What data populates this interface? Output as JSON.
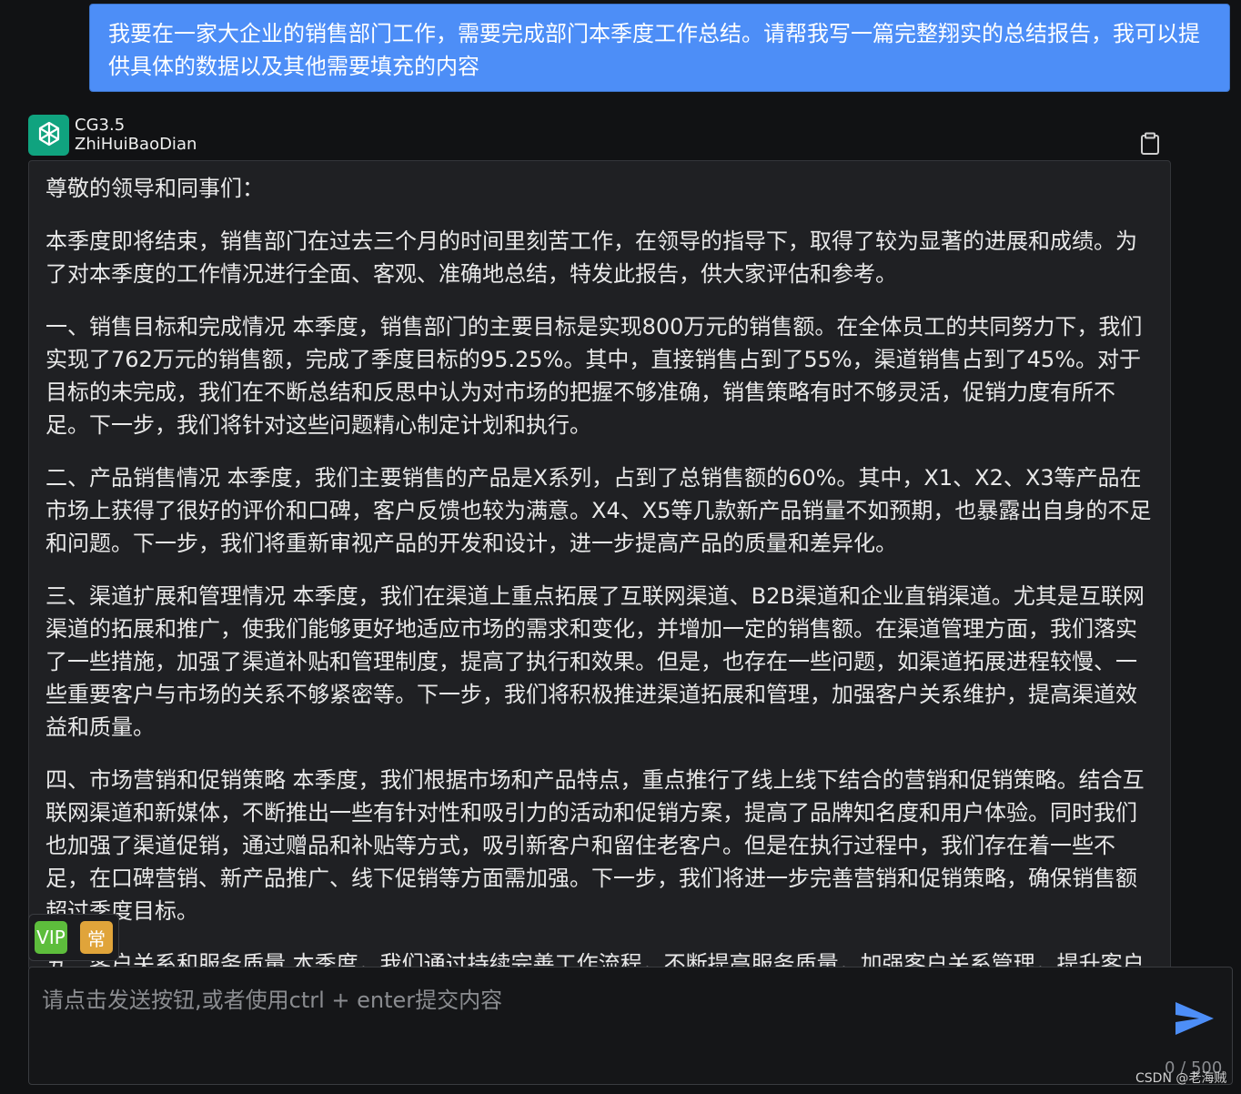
{
  "user_message": {
    "text": "我要在一家大企业的销售部门工作，需要完成部门本季度工作总结。请帮我写一篇完整翔实的总结报告，我可以提供具体的数据以及其他需要填充的内容"
  },
  "bot": {
    "model_name": "CG3.5",
    "bot_name": "ZhiHuiBaoDian",
    "avatar_icon": "openai-logo-icon",
    "copy_icon": "clipboard-icon",
    "paragraphs": [
      "尊敬的领导和同事们：",
      "本季度即将结束，销售部门在过去三个月的时间里刻苦工作，在领导的指导下，取得了较为显著的进展和成绩。为了对本季度的工作情况进行全面、客观、准确地总结，特发此报告，供大家评估和参考。",
      "一、销售目标和完成情况 本季度，销售部门的主要目标是实现800万元的销售额。在全体员工的共同努力下，我们实现了762万元的销售额，完成了季度目标的95.25%。其中，直接销售占到了55%，渠道销售占到了45%。对于目标的未完成，我们在不断总结和反思中认为对市场的把握不够准确，销售策略有时不够灵活，促销力度有所不足。下一步，我们将针对这些问题精心制定计划和执行。",
      "二、产品销售情况 本季度，我们主要销售的产品是X系列，占到了总销售额的60%。其中，X1、X2、X3等产品在市场上获得了很好的评价和口碑，客户反馈也较为满意。X4、X5等几款新产品销量不如预期，也暴露出自身的不足和问题。下一步，我们将重新审视产品的开发和设计，进一步提高产品的质量和差异化。",
      "三、渠道扩展和管理情况 本季度，我们在渠道上重点拓展了互联网渠道、B2B渠道和企业直销渠道。尤其是互联网渠道的拓展和推广，使我们能够更好地适应市场的需求和变化，并增加一定的销售额。在渠道管理方面，我们落实了一些措施，加强了渠道补贴和管理制度，提高了执行和效果。但是，也存在一些问题，如渠道拓展进程较慢、一些重要客户与市场的关系不够紧密等。下一步，我们将积极推进渠道拓展和管理，加强客户关系维护，提高渠道效益和质量。",
      "四、市场营销和促销策略 本季度，我们根据市场和产品特点，重点推行了线上线下结合的营销和促销策略。结合互联网渠道和新媒体，不断推出一些有针对性和吸引力的活动和促销方案，提高了品牌知名度和用户体验。同时我们也加强了渠道促销，通过赠品和补贴等方式，吸引新客户和留住老客户。但是在执行过程中，我们存在着一些不足，在口碑营销、新产品推广、线下促销等方面需加强。下一步，我们将进一步完善营销和促销策略，确保销售额超过季度目标。",
      "五、客户关系和服务质量 本季度，我们通过持续完善工作流程，不断提高服务质量，加强客户关系管理，提升客户满意度。"
    ]
  },
  "badges": {
    "vip_label": "VIP",
    "common_label": "常"
  },
  "input": {
    "placeholder": "请点击发送按钮,或者使用ctrl + enter提交内容",
    "value": "",
    "counter": "0 / 500",
    "send_icon": "send-icon"
  },
  "watermark": "CSDN @老海贼",
  "colors": {
    "background": "#111214",
    "user_bubble": "#4d8ef7",
    "bot_bubble": "#1f2023",
    "send_icon": "#4d8ef7",
    "avatar": "#10a37f",
    "vip_badge": "#5dbd3c",
    "common_badge": "#e0a43a"
  }
}
